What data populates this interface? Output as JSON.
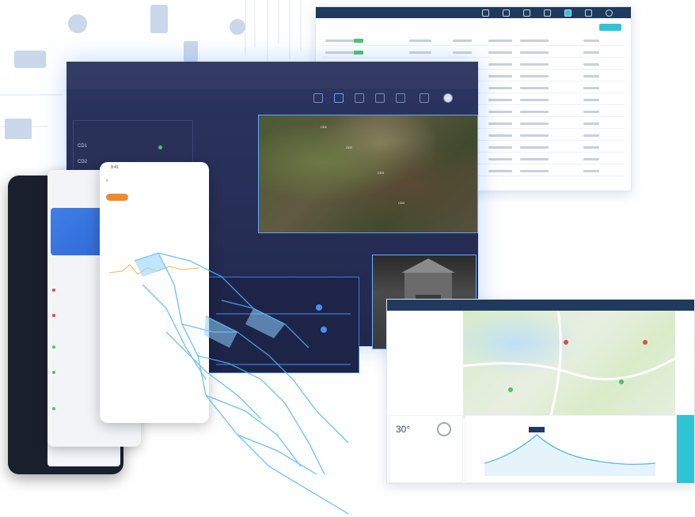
{
  "table_panel": {
    "colors": {
      "header": "#1f3a5c",
      "accent": "#2ec4d6",
      "status": "#4cc36a"
    }
  },
  "dashboard": {
    "sidebar": {
      "items": [
        "CD1",
        "CD2"
      ]
    },
    "satellite_tags": [
      "CD1",
      "CD2",
      "CD3",
      "CD4"
    ],
    "colors": {
      "bg": "#262d55",
      "glow": "#5aa8ff"
    }
  },
  "map_panel": {
    "temperature": "30°"
  },
  "phones": {
    "phone3": {
      "time": "9:41"
    }
  }
}
